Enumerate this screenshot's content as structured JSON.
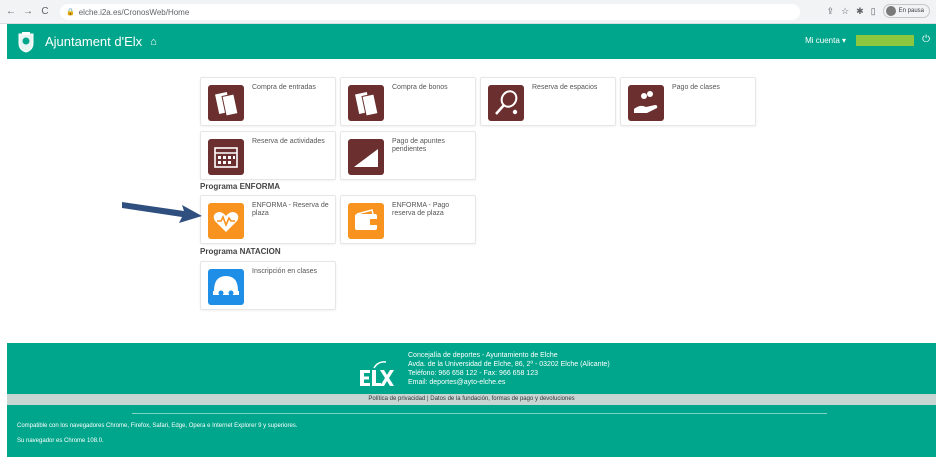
{
  "browser": {
    "url": "elche.i2a.es/CronosWeb/Home",
    "profile_label": "En pausa"
  },
  "header": {
    "title": "Ajuntament d'Elx",
    "account_label": "Mi cuenta ▾"
  },
  "tiles": [
    {
      "label": "Compra de entradas"
    },
    {
      "label": "Compra de bonos"
    },
    {
      "label": "Reserva de espacios"
    },
    {
      "label": "Pago de clases"
    },
    {
      "label": "Reserva de actividades"
    },
    {
      "label": "Pago de apuntes pendientes"
    }
  ],
  "sections": {
    "enforma": {
      "title": "Programa ENFORMA",
      "tiles": [
        {
          "label": "ENFORMA - Reserva de plaza"
        },
        {
          "label": "ENFORMA - Pago reserva de plaza"
        }
      ]
    },
    "natacion": {
      "title": "Programa NATACION",
      "tiles": [
        {
          "label": "Inscripción en clases"
        }
      ]
    }
  },
  "footer": {
    "line1": "Concejalía de deportes - Ayuntamiento de Elche",
    "line2": "Avda. de la Universidad de Elche, 86, 2º - 03202 Elche (Alicante)",
    "line3": "Teléfono: 966 658 122 - Fax: 966 658 123",
    "line4": "Email: deportes@ayto-elche.es",
    "links": "Política de privacidad | Datos de la fundación, formas de pago y devoluciones",
    "compat": "Compatible con los navegadores Chrome, Firefox, Safari, Edge, Opera e Internet Explorer 9 y superiores.",
    "browser_info": "Su navegador es Chrome 108.0."
  },
  "colors": {
    "brand_green": "#00a68b",
    "maroon": "#6b2f2f",
    "orange": "#f7931e",
    "blue": "#1e8ee6",
    "arrow": "#2f4f7f"
  }
}
